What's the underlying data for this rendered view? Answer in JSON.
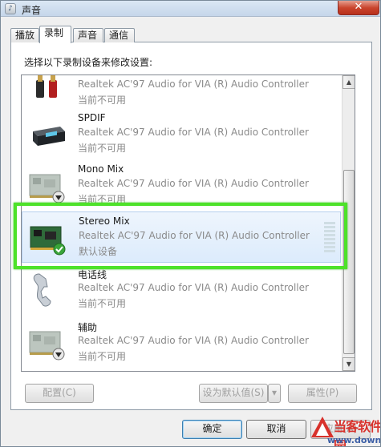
{
  "window": {
    "title": "声音",
    "close_label": "✕"
  },
  "tabs": [
    {
      "label": "播放",
      "active": false
    },
    {
      "label": "录制",
      "active": true
    },
    {
      "label": "声音",
      "active": false
    },
    {
      "label": "通信",
      "active": false
    }
  ],
  "instruction": "选择以下录制设备来修改设置:",
  "devices": [
    {
      "name": "",
      "desc": "Realtek AC'97 Audio for VIA (R) Audio Controller",
      "status": "当前不可用",
      "icon": "rca-cable-icon"
    },
    {
      "name": "SPDIF",
      "desc": "Realtek AC'97 Audio for VIA (R) Audio Controller",
      "status": "当前不可用",
      "icon": "spdif-device-icon"
    },
    {
      "name": "Mono Mix",
      "desc": "Realtek AC'97 Audio for VIA (R) Audio Controller",
      "status": "当前不可用",
      "icon": "sound-card-disabled-icon"
    },
    {
      "name": "Stereo Mix",
      "desc": "Realtek AC'97 Audio for VIA (R) Audio Controller",
      "status": "默认设备",
      "icon": "sound-card-default-icon",
      "selected": true
    },
    {
      "name": "电话线",
      "desc": "Realtek AC'97 Audio for VIA (R) Audio Controller",
      "status": "当前不可用",
      "icon": "telephone-icon"
    },
    {
      "name": "辅助",
      "desc": "Realtek AC'97 Audio for VIA (R) Audio Controller",
      "status": "当前不可用",
      "icon": "sound-card-disabled-icon"
    }
  ],
  "buttons": {
    "configure": "配置(C)",
    "set_default": "设为默认值(S)",
    "set_default_arrow": "▾",
    "properties": "属性(P)",
    "ok": "确定",
    "cancel": "取消",
    "apply": "应用(A)"
  },
  "colors": {
    "highlight": "#4ee22a",
    "default_check": "#3aa53a",
    "watermark_red": "#d8322c"
  },
  "watermark": {
    "text": "当客软件园",
    "url": "www.downkr.com"
  }
}
